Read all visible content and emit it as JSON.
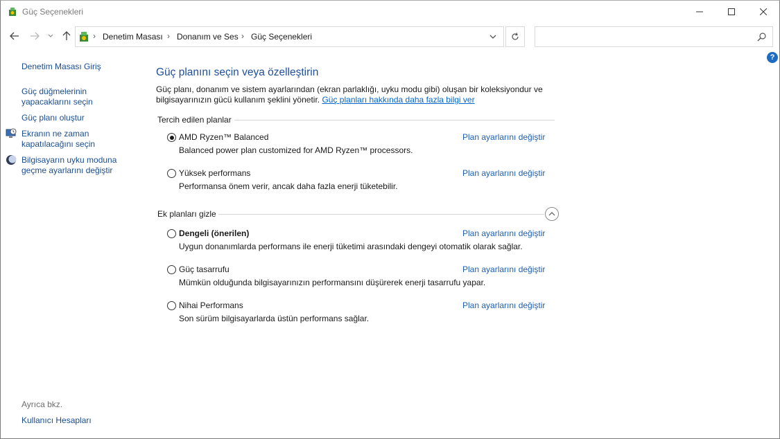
{
  "window": {
    "title": "Güç Seçenekleri"
  },
  "breadcrumb": [
    "Denetim Masası",
    "Donanım ve Ses",
    "Güç Seçenekleri"
  ],
  "search": {
    "placeholder": "",
    "value": ""
  },
  "sidebar": {
    "home": "Denetim Masası Giriş",
    "links": [
      {
        "label_line1": "Güç düğmelerinin",
        "label_line2": "yapacaklarını seçin",
        "icon": ""
      },
      {
        "label_line1": "Güç planı oluştur",
        "label_line2": "",
        "icon": ""
      },
      {
        "label_line1": "Ekranın ne zaman",
        "label_line2": "kapatılacağını seçin",
        "icon": "clock-monitor-icon"
      },
      {
        "label_line1": "Bilgisayarın uyku moduna",
        "label_line2": "geçme ayarlarını değiştir",
        "icon": "moon-icon"
      }
    ],
    "see_also_label": "Ayrıca bkz.",
    "see_also_links": [
      "Kullanıcı Hesapları"
    ]
  },
  "main": {
    "heading": "Güç planını seçin veya özelleştirin",
    "description": "Güç planı, donanım ve sistem ayarlarından (ekran parlaklığı, uyku modu gibi) oluşan bir koleksiyondur ve bilgisayarınızın gücü kullanım şeklini yönetir.",
    "learn_more_link": "Güç planları hakkında daha fazla bilgi ver",
    "preferred_group": "Tercih edilen planlar",
    "additional_group": "Ek planları gizle",
    "change_settings_label": "Plan ayarlarını değiştir",
    "preferred_plans": [
      {
        "name": "AMD Ryzen™ Balanced",
        "description": "Balanced power plan customized for AMD Ryzen™ processors.",
        "selected": true,
        "bold": false
      },
      {
        "name": "Yüksek performans",
        "description": "Performansa önem verir, ancak daha fazla enerji tüketebilir.",
        "selected": false,
        "bold": false
      }
    ],
    "additional_plans": [
      {
        "name": "Dengeli (önerilen)",
        "description": "Uygun donanımlarda performans ile enerji tüketimi arasındaki dengeyi otomatik olarak sağlar.",
        "selected": false,
        "bold": true
      },
      {
        "name": "Güç tasarrufu",
        "description": "Mümkün olduğunda bilgisayarınızın performansını düşürerek enerji tasarrufu yapar.",
        "selected": false,
        "bold": false
      },
      {
        "name": "Nihai Performans",
        "description": "Son sürüm bilgisayarlarda üstün performans sağlar.",
        "selected": false,
        "bold": false
      }
    ]
  },
  "colors": {
    "link": "#1a5fb4",
    "heading": "#1f4e9a",
    "help": "#1e6cc1"
  }
}
